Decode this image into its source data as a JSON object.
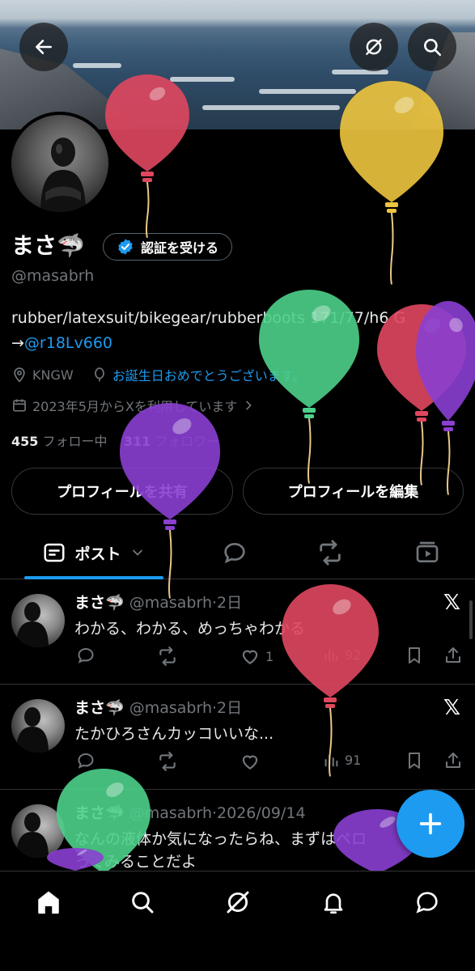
{
  "colors": {
    "accent": "#1d9bf0",
    "muted": "#71767b",
    "balloon_red": "#e0475f",
    "balloon_yellow": "#eec53e",
    "balloon_green": "#4cd08a",
    "balloon_purple": "#8a3fd1"
  },
  "header": {
    "back_icon": "arrow-left-icon",
    "grok_icon": "grok-icon",
    "search_icon": "search-icon"
  },
  "profile": {
    "name": "まさ🦈",
    "verify_label": "認証を受ける",
    "handle": "@masabrh",
    "bio_line1": "rubber/latexsuit/bikegear/rubberboots 171/77/h6 G",
    "bio_arrow": "→",
    "bio_link": "@r18Lv660",
    "location": "KNGW",
    "birthday": "お誕生日おめでとうございます。",
    "joined": "2023年5月からXを利用しています",
    "following_count": "455",
    "following_label": "フォロー中",
    "followers_count": "311",
    "followers_label": "フォロワー",
    "share_button": "プロフィールを共有",
    "edit_button": "プロフィールを編集"
  },
  "tabs": {
    "posts_label": "ポスト"
  },
  "tweets": [
    {
      "name": "まさ🦈",
      "handle": "@masabrh",
      "dot": "·",
      "time": "2日",
      "text": "わかる、わかる、めっちゃわかる",
      "likes": "1",
      "views": "92"
    },
    {
      "name": "まさ🦈",
      "handle": "@masabrh",
      "dot": "·",
      "time": "2日",
      "text": "たかひろさんカッコいいな...",
      "likes": "",
      "views": "91"
    },
    {
      "name": "まさ🦈",
      "handle": "@masabrh",
      "dot": "·",
      "time": "2026/09/14",
      "text": "なんの液体か気になったらね、まずはペロ",
      "text2": "ってみることだよ"
    }
  ],
  "x_logo": "𝕏"
}
